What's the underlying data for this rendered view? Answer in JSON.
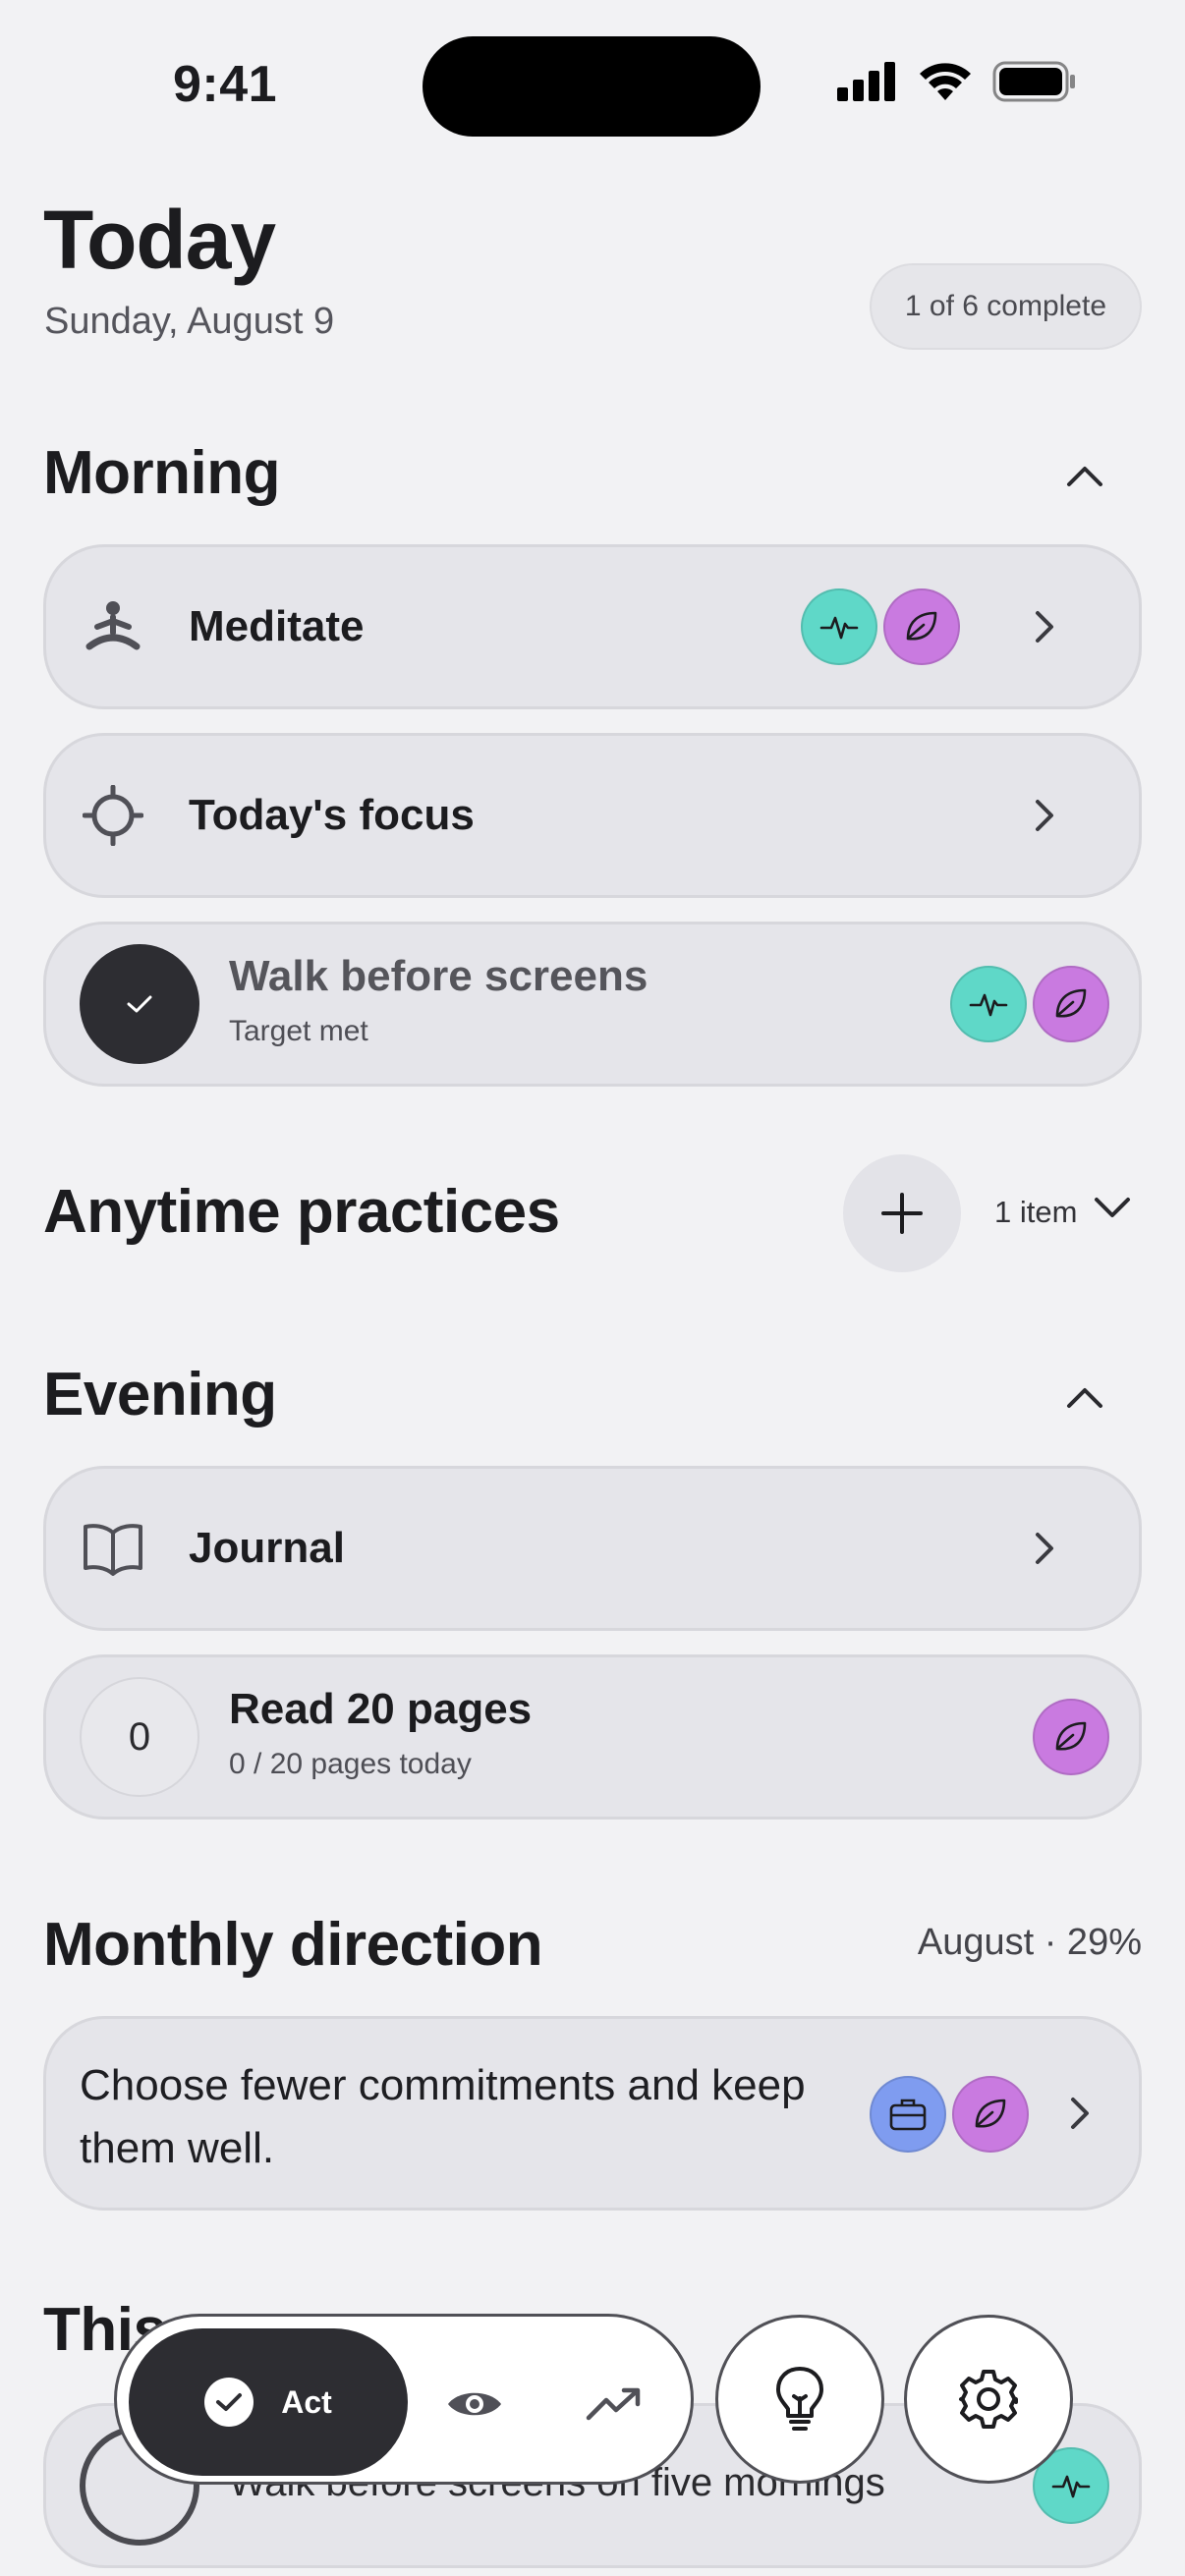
{
  "status": {
    "time": "9:41"
  },
  "header": {
    "title": "Today",
    "date": "Sunday, August 9",
    "progress": "1 of 6 complete"
  },
  "morning": {
    "title": "Morning",
    "items": [
      {
        "label": "Meditate",
        "icon": "meditation-icon",
        "tags": [
          "health",
          "calm"
        ]
      },
      {
        "label": "Today's focus",
        "icon": "crosshair-icon"
      },
      {
        "label": "Walk before screens",
        "status": "Target met",
        "completed": true,
        "tags": [
          "health",
          "calm"
        ]
      }
    ]
  },
  "anytime": {
    "title": "Anytime practices",
    "count": "1 item"
  },
  "evening": {
    "title": "Evening",
    "items": [
      {
        "label": "Journal",
        "icon": "book-icon"
      },
      {
        "label": "Read 20 pages",
        "count": "0",
        "progress": "0 / 20 pages today",
        "tags": [
          "calm"
        ]
      }
    ]
  },
  "monthly": {
    "title": "Monthly direction",
    "meta": "August · 29%",
    "text": "Choose fewer commitments and keep them well.",
    "tags": [
      "work",
      "calm"
    ]
  },
  "weekly": {
    "title": "This",
    "item": "Walk before screens on five mornings"
  },
  "nav": {
    "act": "Act",
    "items": [
      "eye-icon",
      "trend-icon",
      "lightbulb-icon",
      "gear-icon"
    ]
  },
  "colors": {
    "teal": "#5fd8c8",
    "purple": "#c97ae0",
    "blue": "#7f9cf0",
    "dark": "#2d2d32"
  }
}
